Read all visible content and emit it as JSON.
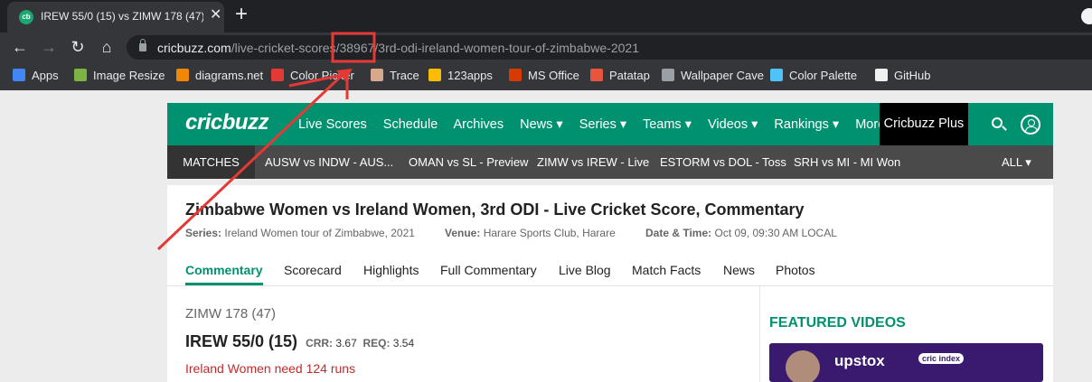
{
  "browser": {
    "tab_title": "IREW 55/0 (15) vs ZIMW 178 (47)",
    "tab_close": "✕",
    "new_tab": "+",
    "url_domain": "cricbuzz.com",
    "url_path": "/live-cricket-scores/38967/3rd-odi-ireland-women-tour-of-zimbabwe-2021",
    "bookmarks": [
      {
        "label": "Apps",
        "icon": "apps-grid-icon",
        "color": "#4285f4"
      },
      {
        "label": "Image Resize",
        "icon": "image-resize-icon",
        "color": "#7cb342"
      },
      {
        "label": "diagrams.net",
        "icon": "diagrams-icon",
        "color": "#f08705"
      },
      {
        "label": "Color Picker",
        "icon": "color-picker-icon",
        "color": "#e53935"
      },
      {
        "label": "Trace",
        "icon": "trace-icon",
        "color": "#d7a98c"
      },
      {
        "label": "123apps",
        "icon": "apps123-icon",
        "color": "#fbbc05"
      },
      {
        "label": "MS Office",
        "icon": "office-icon",
        "color": "#d83b01"
      },
      {
        "label": "Patatap",
        "icon": "patatap-icon",
        "color": "#e8553e"
      },
      {
        "label": "Wallpaper Cave",
        "icon": "wallpaper-icon",
        "color": "#9aa0a6"
      },
      {
        "label": "Color Palette",
        "icon": "palette-icon",
        "color": "#4fc3f7"
      },
      {
        "label": "GitHub",
        "icon": "github-icon",
        "color": "#f1f1f1"
      }
    ]
  },
  "site": {
    "logo": "cricbuzz",
    "nav": [
      "Live Scores",
      "Schedule",
      "Archives",
      "News ▾",
      "Series ▾",
      "Teams ▾",
      "Videos ▾",
      "Rankings ▾",
      "More ▾"
    ],
    "plus": "Cricbuzz Plus",
    "matches_label": "MATCHES",
    "matches": [
      "AUSW vs INDW - AUS...",
      "OMAN vs SL - Preview",
      "ZIMW vs IREW - Live",
      "ESTORM vs DOL - Toss",
      "SRH vs MI - MI Won"
    ],
    "all_label": "ALL ▾",
    "brand_color": "#009270"
  },
  "page": {
    "title": "Zimbabwe Women vs Ireland Women, 3rd ODI - Live Cricket Score, Commentary",
    "series_label": "Series:",
    "series": "Ireland Women tour of Zimbabwe, 2021",
    "venue_label": "Venue:",
    "venue": "Harare Sports Club, Harare",
    "datetime_label": "Date & Time:",
    "datetime": "Oct 09, 09:30 AM LOCAL",
    "tabs": [
      "Commentary",
      "Scorecard",
      "Highlights",
      "Full Commentary",
      "Live Blog",
      "Match Facts",
      "News",
      "Photos"
    ],
    "score_prev": "ZIMW 178 (47)",
    "score_main": "IREW 55/0 (15)",
    "crr_label": "CRR:",
    "crr": "3.67",
    "req_label": "REQ:",
    "req": "3.54",
    "status": "Ireland Women need 124 runs",
    "featured": "FEATURED VIDEOS",
    "video_brand": "upstox",
    "video_badge": "cric index"
  }
}
